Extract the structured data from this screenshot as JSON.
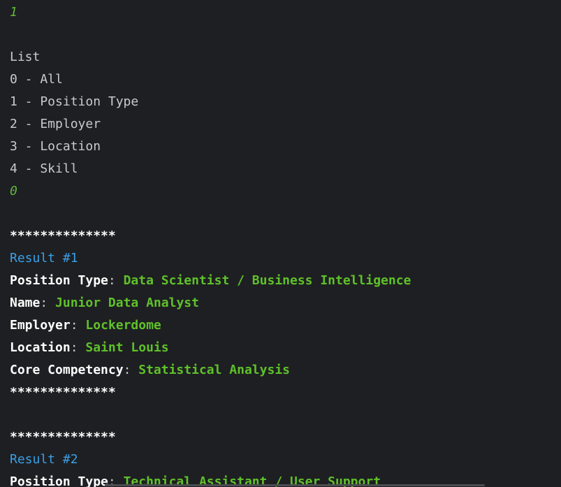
{
  "console": {
    "input_1": "1",
    "menu_header": "List",
    "menu_items": [
      "0 - All",
      "1 - Position Type",
      "2 - Employer",
      "3 - Location",
      "4 - Skill"
    ],
    "input_2": "0",
    "stars": "**************",
    "results": [
      {
        "heading": "Result #1",
        "fields": [
          {
            "label": "Position Type",
            "sep": ": ",
            "value": "Data Scientist / Business Intelligence"
          },
          {
            "label": "Name",
            "sep": ": ",
            "value": "Junior Data Analyst"
          },
          {
            "label": "Employer",
            "sep": ": ",
            "value": "Lockerdome"
          },
          {
            "label": "Location",
            "sep": ": ",
            "value": "Saint Louis"
          },
          {
            "label": "Core Competency",
            "sep": ": ",
            "value": "Statistical Analysis"
          }
        ]
      },
      {
        "heading": "Result #2",
        "fields": [
          {
            "label": "Position Type",
            "sep": ": ",
            "value": "Technical Assistant / User Support"
          }
        ]
      }
    ]
  },
  "colors": {
    "background": "#1e1f22",
    "input_echo": "#5fb83a",
    "result_heading": "#3aa0e8",
    "field_value": "#5fc12a",
    "label": "#ffffff"
  }
}
